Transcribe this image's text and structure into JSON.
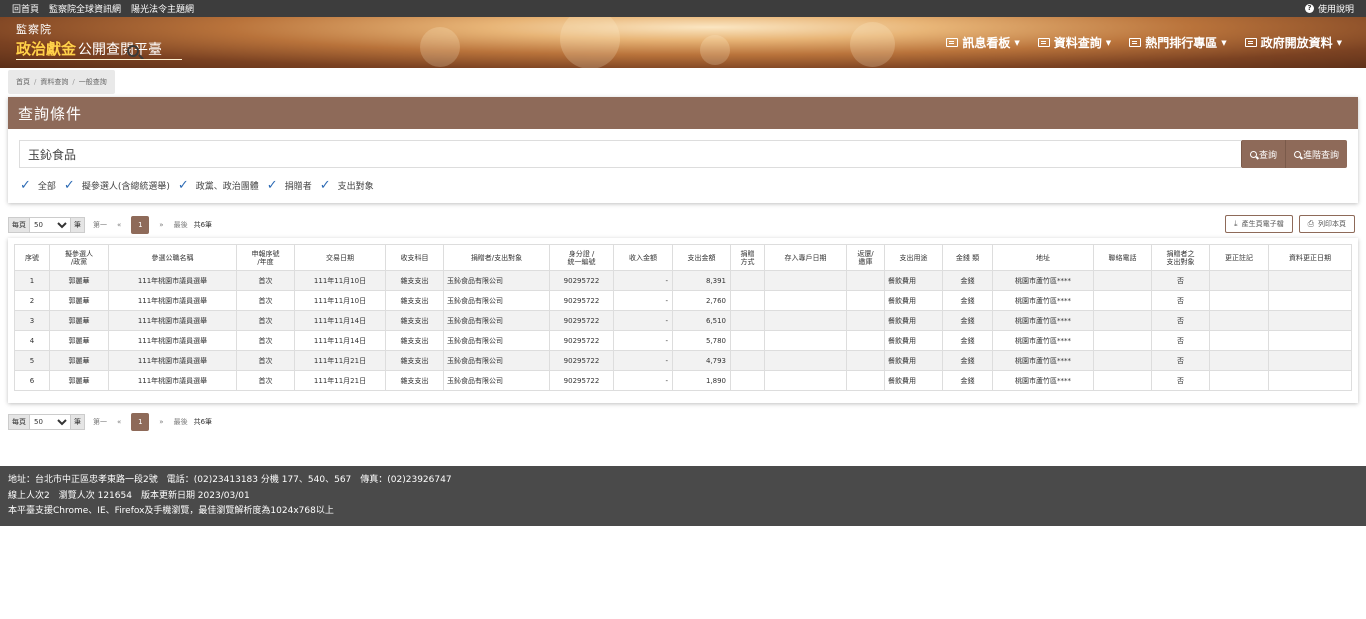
{
  "topbar": {
    "links": [
      "回首頁",
      "監察院全球資訊網",
      "陽光法令主題網"
    ],
    "help": "使用說明"
  },
  "logo": {
    "agency": "監察院",
    "title_gold": "政治獻金",
    "title_white": "公開查閱平臺"
  },
  "nav": [
    "訊息看板",
    "資料查詢",
    "熱門排行專區",
    "政府開放資料"
  ],
  "breadcrumb": [
    "首頁",
    "資料查詢",
    "一般查詢"
  ],
  "panel": {
    "title": "查詢條件",
    "search_value": "玉鈊食品",
    "search_button": "查詢",
    "advanced_button": "進階查詢",
    "checks": [
      "全部",
      "擬參選人(含總統選舉)",
      "政黨、政治團體",
      "捐贈者",
      "支出對象"
    ]
  },
  "pager": {
    "per_page_label": "每頁",
    "per_page_value": "50",
    "unit": "筆",
    "first": "第一",
    "prev": "«",
    "current": "1",
    "next": "»",
    "last": "最後",
    "total": "共6筆"
  },
  "tools": {
    "export": "產生頁電子檔",
    "print": "列印本頁"
  },
  "table": {
    "headers": [
      "序號",
      "擬參選人\n/政黨",
      "參選公職名稱",
      "申報序號\n/年度",
      "交易日期",
      "收支科目",
      "捐贈者/支出對象",
      "身分證 /\n統一編號",
      "收入金額",
      "支出金額",
      "捐贈\n方式",
      "存入專戶日期",
      "返還/\n繳庫",
      "支出用途",
      "金錢 類",
      "地址",
      "聯絡電話",
      "捐贈者之\n支出對象",
      "更正註記",
      "資料更正日期"
    ],
    "rows": [
      [
        "1",
        "郭麗華",
        "111年桃園市議員選舉",
        "首次",
        "111年11月10日",
        "雜支支出",
        "玉鈊食品有限公司",
        "90295722",
        "-",
        "8,391",
        "",
        "",
        "",
        "餐飲費用",
        "金錢",
        "桃園市蘆竹區****",
        "",
        "否",
        "",
        ""
      ],
      [
        "2",
        "郭麗華",
        "111年桃園市議員選舉",
        "首次",
        "111年11月10日",
        "雜支支出",
        "玉鈊食品有限公司",
        "90295722",
        "-",
        "2,760",
        "",
        "",
        "",
        "餐飲費用",
        "金錢",
        "桃園市蘆竹區****",
        "",
        "否",
        "",
        ""
      ],
      [
        "3",
        "郭麗華",
        "111年桃園市議員選舉",
        "首次",
        "111年11月14日",
        "雜支支出",
        "玉鈊食品有限公司",
        "90295722",
        "-",
        "6,510",
        "",
        "",
        "",
        "餐飲費用",
        "金錢",
        "桃園市蘆竹區****",
        "",
        "否",
        "",
        ""
      ],
      [
        "4",
        "郭麗華",
        "111年桃園市議員選舉",
        "首次",
        "111年11月14日",
        "雜支支出",
        "玉鈊食品有限公司",
        "90295722",
        "-",
        "5,780",
        "",
        "",
        "",
        "餐飲費用",
        "金錢",
        "桃園市蘆竹區****",
        "",
        "否",
        "",
        ""
      ],
      [
        "5",
        "郭麗華",
        "111年桃園市議員選舉",
        "首次",
        "111年11月21日",
        "雜支支出",
        "玉鈊食品有限公司",
        "90295722",
        "-",
        "4,793",
        "",
        "",
        "",
        "餐飲費用",
        "金錢",
        "桃園市蘆竹區****",
        "",
        "否",
        "",
        ""
      ],
      [
        "6",
        "郭麗華",
        "111年桃園市議員選舉",
        "首次",
        "111年11月21日",
        "雜支支出",
        "玉鈊食品有限公司",
        "90295722",
        "-",
        "1,890",
        "",
        "",
        "",
        "餐飲費用",
        "金錢",
        "桃園市蘆竹區****",
        "",
        "否",
        "",
        ""
      ]
    ]
  },
  "footer": {
    "line1": "地址：台北市中正區忠孝東路一段2號　電話：(02)23413183 分機 177、540、567　傳真：(02)23926747",
    "line2": "線上人次2　瀏覽人次 121654　版本更新日期 2023/03/01",
    "line3": "本平臺支援Chrome、IE、Firefox及手機瀏覽，最佳瀏覽解析度為1024x768以上"
  },
  "colors": {
    "accent": "#8e6a59",
    "topbar": "#3d3d3d",
    "footer": "#4a4a4a",
    "check": "#2d6bb5"
  }
}
